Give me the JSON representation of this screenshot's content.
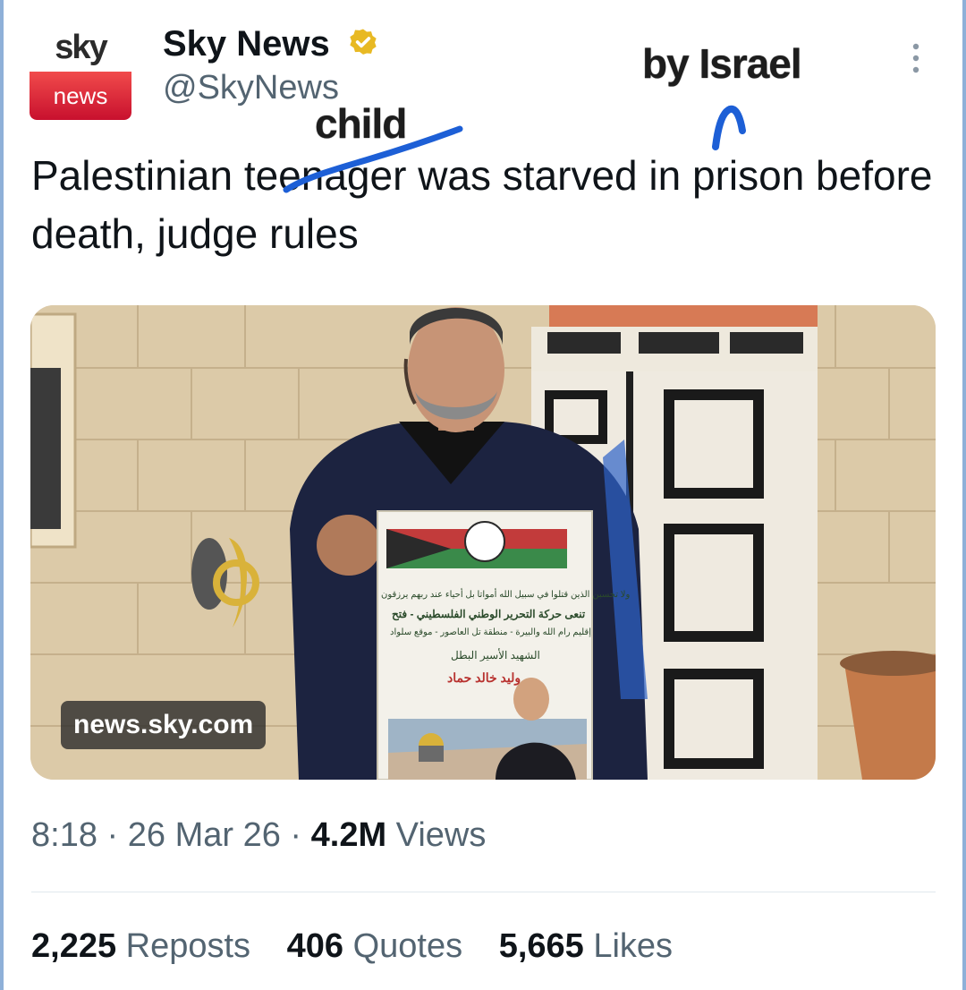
{
  "account": {
    "display_name": "Sky News",
    "handle": "@SkyNews",
    "verified": true,
    "avatar_logo": {
      "top": "sky",
      "bottom": "news"
    }
  },
  "annotations": {
    "inserted_word": "child",
    "appended_text": "by Israel"
  },
  "tweet": {
    "text": "Palestinian teenager was starved in prison before death, judge rules",
    "struck_word": "teenager"
  },
  "media": {
    "source_label": "news.sky.com",
    "poster_lines": [
      "ولا تحسبن الذين قتلوا في سبيل الله أمواتا بل أحياء عند ربهم يرزقون",
      "تنعى حركة التحرير الوطني الفلسطيني - فتح",
      "إقليم رام الله والبيرة - منطقة تل العاصور - موقع سلواد",
      "الشهيد الأسير البطل",
      "وليد خالد حماد"
    ]
  },
  "meta": {
    "time": "8:18",
    "date": "26 Mar 26",
    "views_count": "4.2M",
    "views_label": "Views",
    "separator": "·"
  },
  "stats": [
    {
      "count": "2,225",
      "label": "Reposts"
    },
    {
      "count": "406",
      "label": "Quotes"
    },
    {
      "count": "5,665",
      "label": "Likes"
    }
  ],
  "colors": {
    "text_primary": "#0f1419",
    "text_secondary": "#536471",
    "verified_badge": "#e8b923",
    "annotation_blue": "#1d5fd6",
    "sky_red": "#c8102e"
  }
}
